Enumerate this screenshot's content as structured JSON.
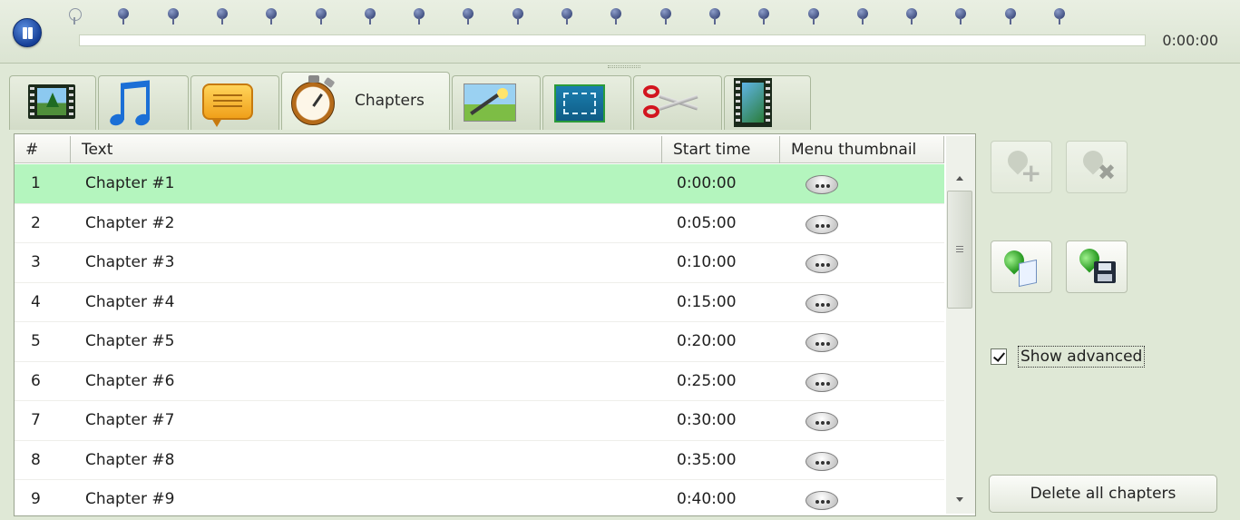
{
  "player": {
    "time": "0:00:00",
    "chapter_marker_count": 21
  },
  "tabs": [
    {
      "name": "video",
      "icon": "film-icon",
      "label": ""
    },
    {
      "name": "audio",
      "icon": "music-icon",
      "label": ""
    },
    {
      "name": "subtitles",
      "icon": "subtitle-bubble-icon",
      "label": ""
    },
    {
      "name": "chapters",
      "icon": "stopwatch-icon",
      "label": "Chapters",
      "active": true
    },
    {
      "name": "image",
      "icon": "image-edit-icon",
      "label": ""
    },
    {
      "name": "resize",
      "icon": "fit-screen-icon",
      "label": ""
    },
    {
      "name": "cut",
      "icon": "scissors-icon",
      "label": ""
    },
    {
      "name": "transition",
      "icon": "film-transition-icon",
      "label": ""
    }
  ],
  "table": {
    "columns": [
      "#",
      "Text",
      "Start time",
      "Menu thumbnail"
    ],
    "rows": [
      {
        "num": "1",
        "text": "Chapter #1",
        "start": "0:00:00",
        "selected": true
      },
      {
        "num": "2",
        "text": "Chapter #2",
        "start": "0:05:00"
      },
      {
        "num": "3",
        "text": "Chapter #3",
        "start": "0:10:00"
      },
      {
        "num": "4",
        "text": "Chapter #4",
        "start": "0:15:00"
      },
      {
        "num": "5",
        "text": "Chapter #5",
        "start": "0:20:00"
      },
      {
        "num": "6",
        "text": "Chapter #6",
        "start": "0:25:00"
      },
      {
        "num": "7",
        "text": "Chapter #7",
        "start": "0:30:00"
      },
      {
        "num": "8",
        "text": "Chapter #8",
        "start": "0:35:00"
      },
      {
        "num": "9",
        "text": "Chapter #9",
        "start": "0:40:00"
      }
    ]
  },
  "right_panel": {
    "add_chapter_icon": "add-chapter-icon",
    "remove_chapter_icon": "remove-chapter-icon",
    "load_chapters_icon": "load-chapters-icon",
    "save_chapters_icon": "save-chapters-icon",
    "show_advanced_label": "Show advanced",
    "show_advanced_checked": true,
    "delete_all_label": "Delete all chapters"
  },
  "colors": {
    "selected_row": "#b4f5be",
    "background": "#dfe8d6"
  }
}
